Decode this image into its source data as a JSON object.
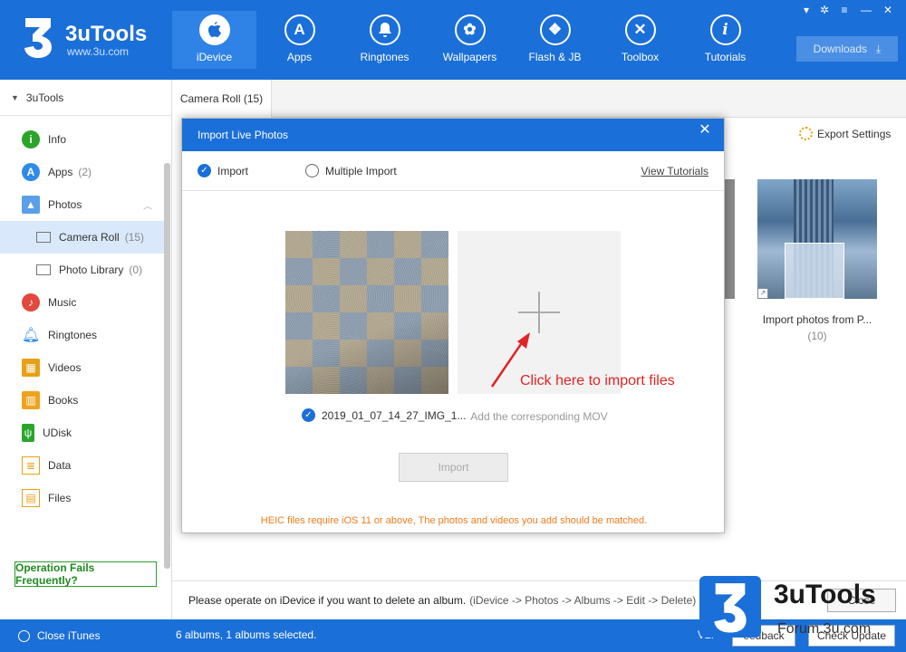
{
  "app": {
    "name": "3uTools",
    "url": "www.3u.com"
  },
  "nav": [
    {
      "label": "iDevice",
      "glyph": ""
    },
    {
      "label": "Apps",
      "glyph": "A"
    },
    {
      "label": "Ringtones",
      "glyph": "♪"
    },
    {
      "label": "Wallpapers",
      "glyph": "✿"
    },
    {
      "label": "Flash & JB",
      "glyph": "❖"
    },
    {
      "label": "Toolbox",
      "glyph": "✕"
    },
    {
      "label": "Tutorials",
      "glyph": "i"
    }
  ],
  "downloads_label": "Downloads",
  "sidebar": {
    "root": "3uTools",
    "items": [
      {
        "label": "Info",
        "count": "",
        "color": "#2aa52a"
      },
      {
        "label": "Apps",
        "count": "(2)",
        "color": "#2f8be8"
      },
      {
        "label": "Photos",
        "count": "",
        "color": "#5aa0e8"
      },
      {
        "label": "Camera Roll",
        "count": "(15)",
        "color": "#ffffff"
      },
      {
        "label": "Photo Library",
        "count": "(0)",
        "color": "#ffffff"
      },
      {
        "label": "Music",
        "count": "",
        "color": "#e2483d"
      },
      {
        "label": "Ringtones",
        "count": "",
        "color": "#2f8be8"
      },
      {
        "label": "Videos",
        "count": "",
        "color": "#e8a017"
      },
      {
        "label": "Books",
        "count": "",
        "color": "#f0a21e"
      },
      {
        "label": "UDisk",
        "count": "",
        "color": "#2aa52a"
      },
      {
        "label": "Data",
        "count": "",
        "color": "#e8a017"
      },
      {
        "label": "Files",
        "count": "",
        "color": "#e8a017"
      }
    ],
    "help_button": "Operation Fails Frequently?"
  },
  "main": {
    "tab": "Camera Roll (15)",
    "export_settings": "Export Settings",
    "album_title": "Import photos from P...",
    "album_count": "(10)",
    "notice": "Please operate on iDevice if you want to delete an album.",
    "notice_path": "(iDevice -> Photos -> Albums -> Edit -> Delete)",
    "notice_close": "Close"
  },
  "modal": {
    "title": "Import Live Photos",
    "close_glyph": "✕",
    "mode_import": "Import",
    "mode_multiple": "Multiple Import",
    "view_tutorials": "View Tutorials",
    "photo_name": "2019_01_07_14_27_IMG_1...",
    "drop_label": "Add the corresponding MOV",
    "hint": "Click here to import files",
    "import_button": "Import",
    "warning": "HEIC files require iOS 11 or above, The photos and videos you add should be matched."
  },
  "bottom": {
    "close_itunes": "Close iTunes",
    "status": "6 albums, 1 albums selected.",
    "version": "V2.",
    "feedback": "eedback",
    "check_update": "Check Update"
  },
  "watermark": {
    "brand": "3uTools",
    "forum": "Forum.3u.com"
  }
}
